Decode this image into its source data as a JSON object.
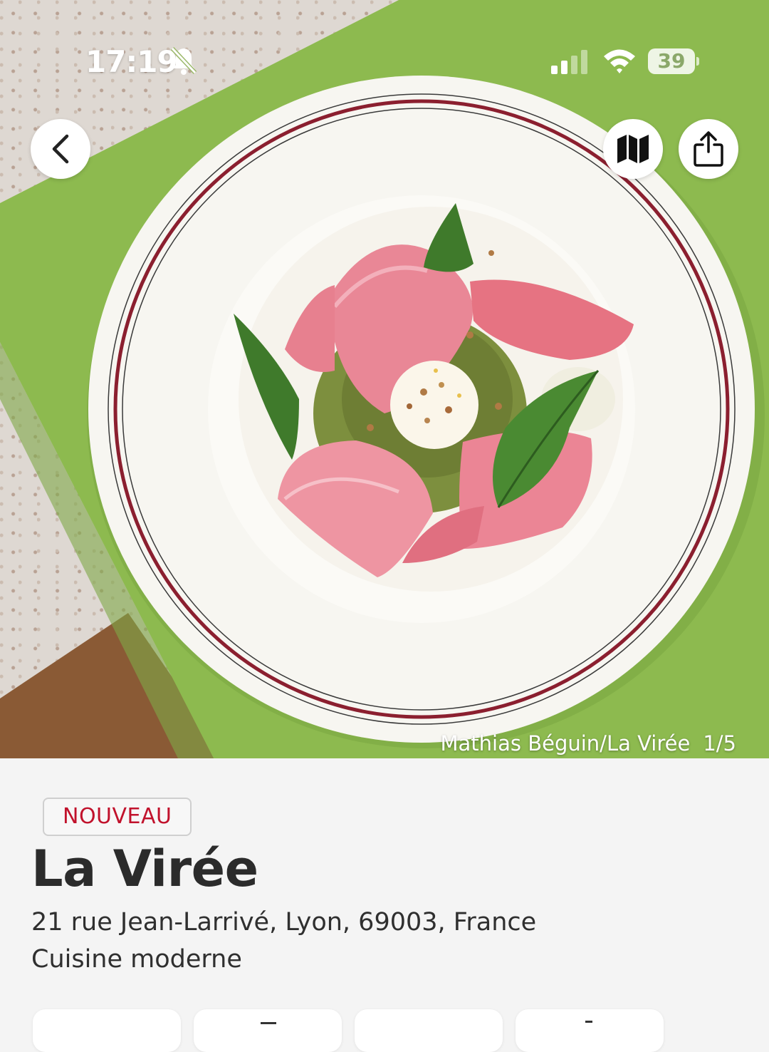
{
  "status_bar": {
    "time": "17:19",
    "battery": "39",
    "icons": [
      "bell-slash-icon",
      "cellular-signal-icon",
      "wifi-icon",
      "battery-icon"
    ]
  },
  "hero": {
    "credit": "Mathias Béguin/La Virée",
    "counter": "1/5",
    "colors": {
      "table": "#8dba4f",
      "plate": "#f7f6f1",
      "plate_rim": "#8b1f2f",
      "radish": "#e98796",
      "leaf": "#3f7a2b"
    }
  },
  "nav": {
    "back_icon": "chevron-left-icon",
    "map_icon": "map-icon",
    "share_icon": "share-icon"
  },
  "restaurant": {
    "badge": "NOUVEAU",
    "name": "La Virée",
    "address": "21 rue Jean-Larrivé, Lyon, 69003, France",
    "cuisine": "Cuisine moderne"
  },
  "colors": {
    "accent_red": "#c1122c",
    "text": "#2b2b2b",
    "card_bg": "#f4f4f4"
  }
}
